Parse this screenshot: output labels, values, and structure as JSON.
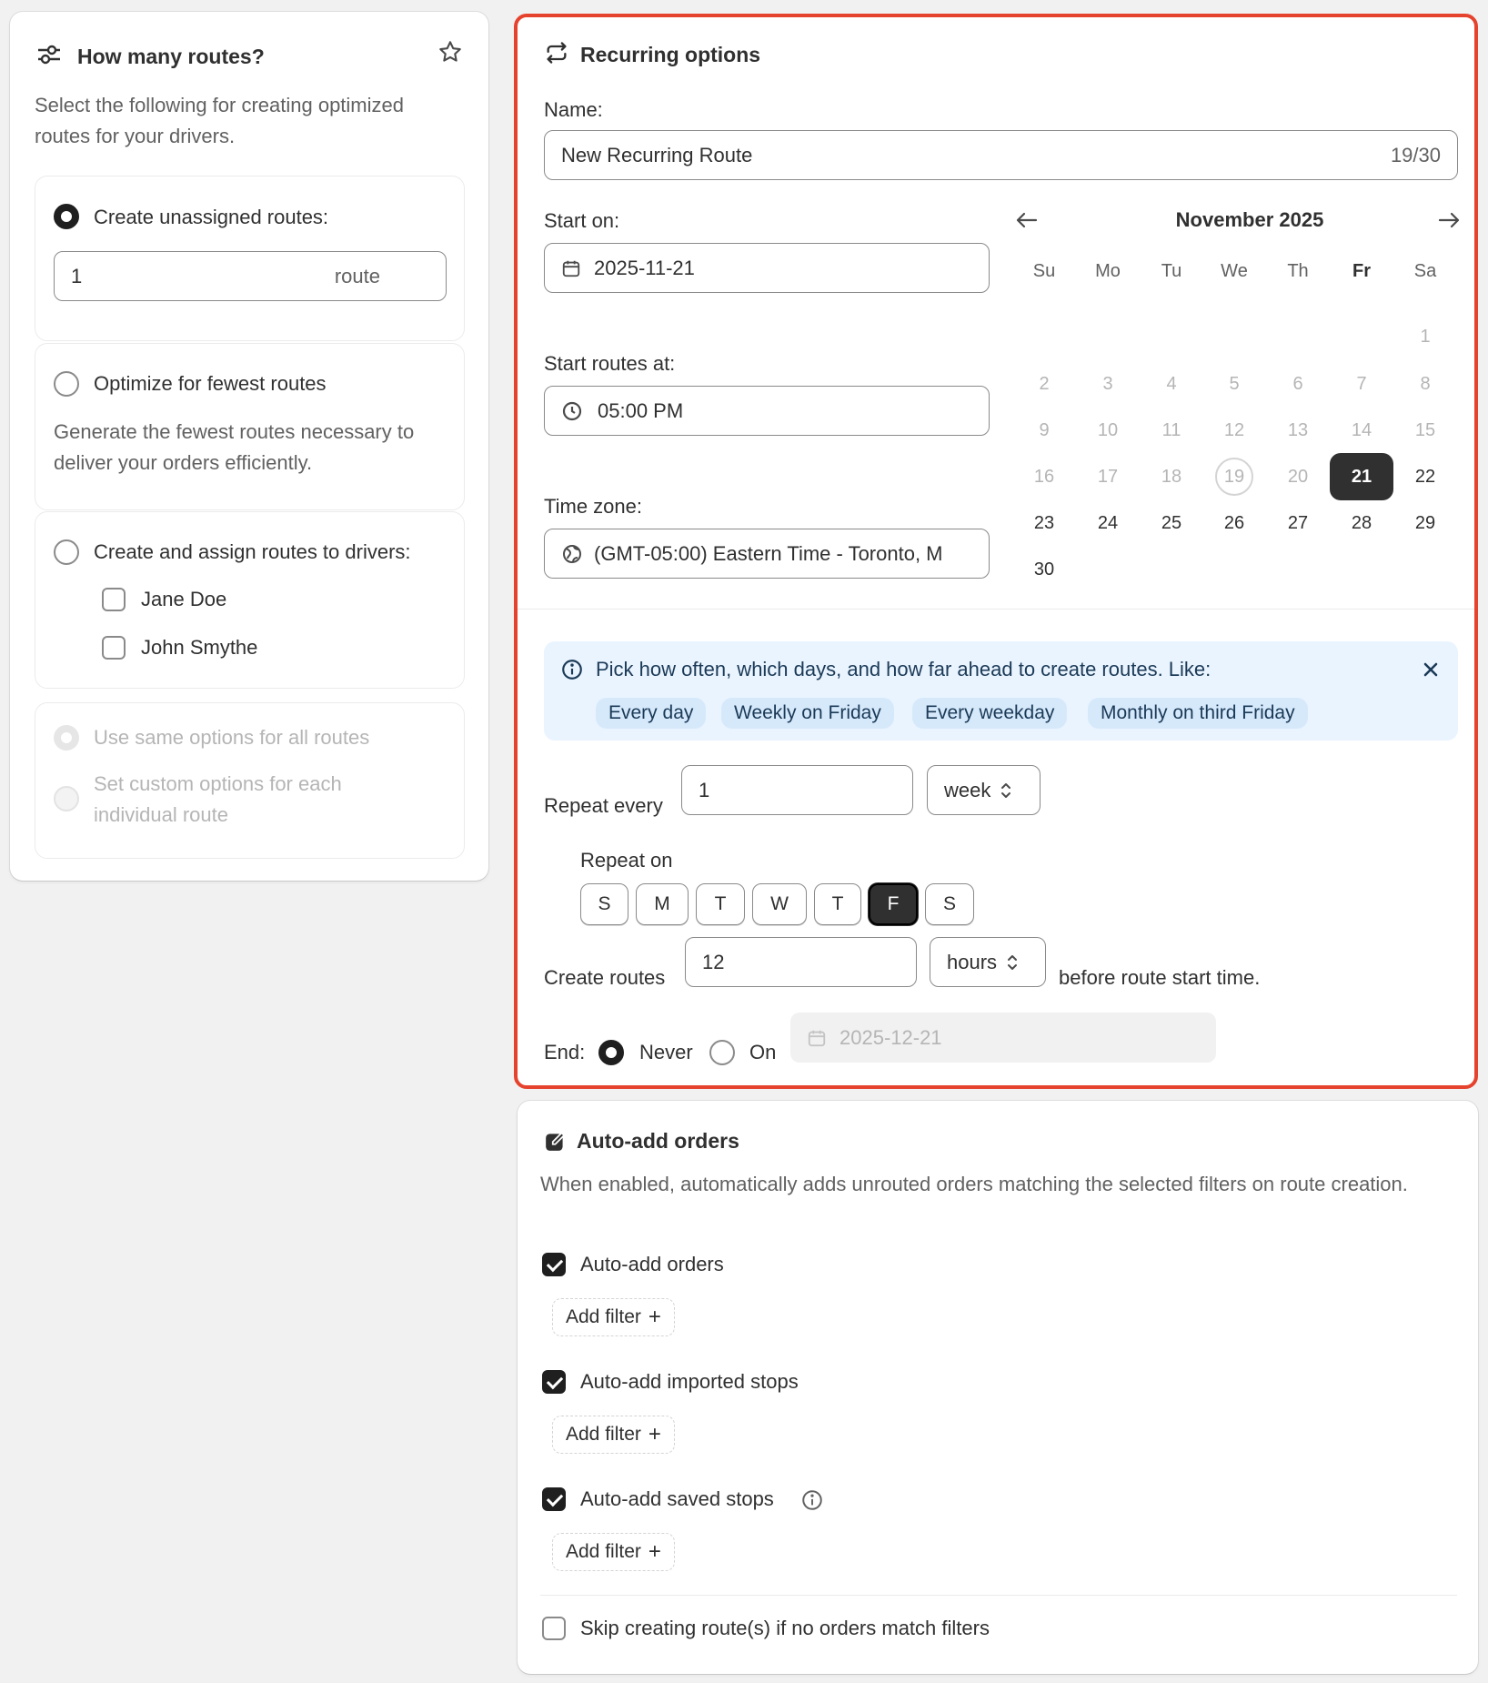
{
  "left": {
    "title": "How many routes?",
    "description": "Select the following for creating optimized routes for your drivers.",
    "option_unassigned": {
      "label": "Create unassigned routes:",
      "value": "1",
      "suffix": "route"
    },
    "option_fewest": {
      "label": "Optimize for fewest routes",
      "description": "Generate the fewest routes necessary to deliver your orders efficiently."
    },
    "option_assign": {
      "label": "Create and assign routes to drivers:",
      "drivers": [
        "Jane Doe",
        "John Smythe"
      ]
    },
    "option_same": {
      "label": "Use same options for all routes"
    },
    "option_custom": {
      "label": "Set custom options for each individual route"
    }
  },
  "recurring": {
    "title": "Recurring options",
    "name_label": "Name:",
    "name_value": "New Recurring Route",
    "name_count": "19/30",
    "start_label": "Start on:",
    "start_value": "2025-11-21",
    "time_label": "Start routes at:",
    "time_value": "05:00 PM",
    "tz_label": "Time zone:",
    "tz_value": "(GMT-05:00) Eastern Time - Toronto, M",
    "calendar": {
      "month": "November 2025",
      "weekdays": [
        "Su",
        "Mo",
        "Tu",
        "We",
        "Th",
        "Fr",
        "Sa"
      ],
      "selected": "21",
      "today": "19"
    },
    "info": {
      "text": "Pick how often, which days, and how far ahead to create routes. Like:",
      "chips": [
        "Every day",
        "Weekly on Friday",
        "Every weekday",
        "Monthly on third Friday"
      ]
    },
    "repeat_label": "Repeat every",
    "repeat_value": "1",
    "repeat_unit": "week",
    "repeat_on_label": "Repeat on",
    "days": [
      "S",
      "M",
      "T",
      "W",
      "T",
      "F",
      "S"
    ],
    "create_label": "Create routes",
    "create_value": "12",
    "create_unit": "hours",
    "create_suffix": "before route start time.",
    "end_label": "End:",
    "end_never": "Never",
    "end_on": "On",
    "end_date": "2025-12-21"
  },
  "autoadd": {
    "title": "Auto-add orders",
    "description": "When enabled, automatically adds unrouted orders matching the selected filters on route creation.",
    "items": [
      "Auto-add orders",
      "Auto-add imported stops",
      "Auto-add saved stops"
    ],
    "add_filter": "Add filter",
    "skip": "Skip creating route(s) if no orders match filters"
  },
  "colors": {
    "accent_border": "#e5432e",
    "selected": "#303030",
    "info_bg": "#eaf4ff"
  }
}
